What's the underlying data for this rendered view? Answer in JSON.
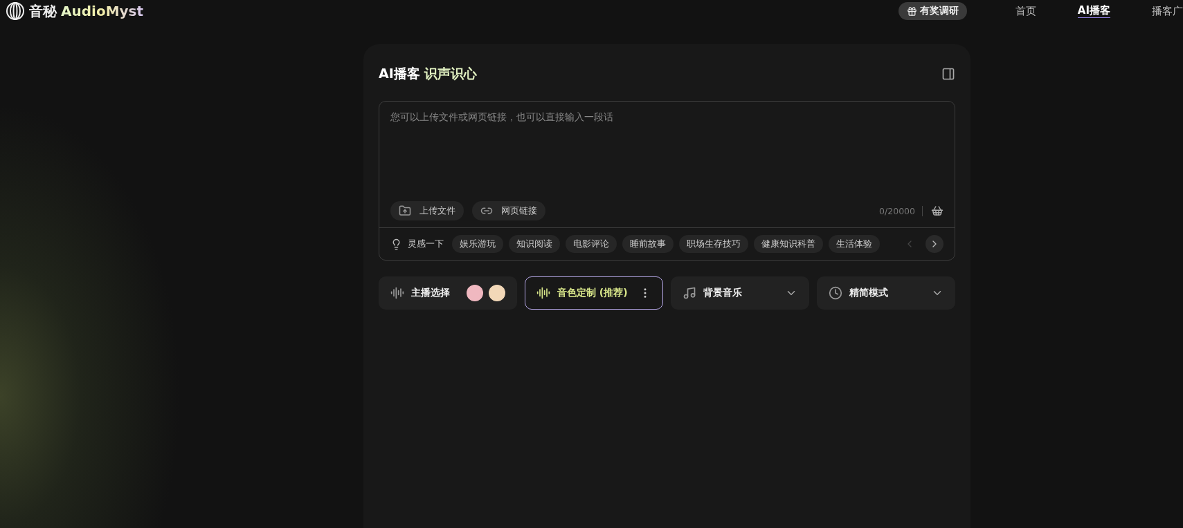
{
  "header": {
    "logo_cn": "音秘",
    "logo_en": "AudioMyst",
    "survey_button": "有奖调研",
    "nav": [
      {
        "label": "首页",
        "selected": false
      },
      {
        "label": "AI播客",
        "selected": true
      },
      {
        "label": "播客广",
        "selected": false
      }
    ]
  },
  "card": {
    "title": "AI播客",
    "title_highlight": "识声识心",
    "input": {
      "placeholder": "您可以上传文件或网页链接，也可以直接输入一段话",
      "counter": "0/20000",
      "actions": [
        {
          "kind": "upload",
          "label": "上传文件"
        },
        {
          "kind": "link",
          "label": "网页链接"
        }
      ]
    },
    "inspiration": {
      "label": "灵感一下",
      "tags": [
        "娱乐游玩",
        "知识阅读",
        "电影评论",
        "睡前故事",
        "职场生存技巧",
        "健康知识科普",
        "生活体验"
      ],
      "prev_disabled": true,
      "next_disabled": false
    },
    "options": [
      {
        "kind": "hosts",
        "label": "主播选择",
        "selected": false
      },
      {
        "kind": "voice",
        "label": "音色定制 (推荐)",
        "selected": true
      },
      {
        "kind": "music",
        "label": "背景音乐",
        "selected": false
      },
      {
        "kind": "mode",
        "label": "精简模式",
        "selected": false
      }
    ]
  }
}
